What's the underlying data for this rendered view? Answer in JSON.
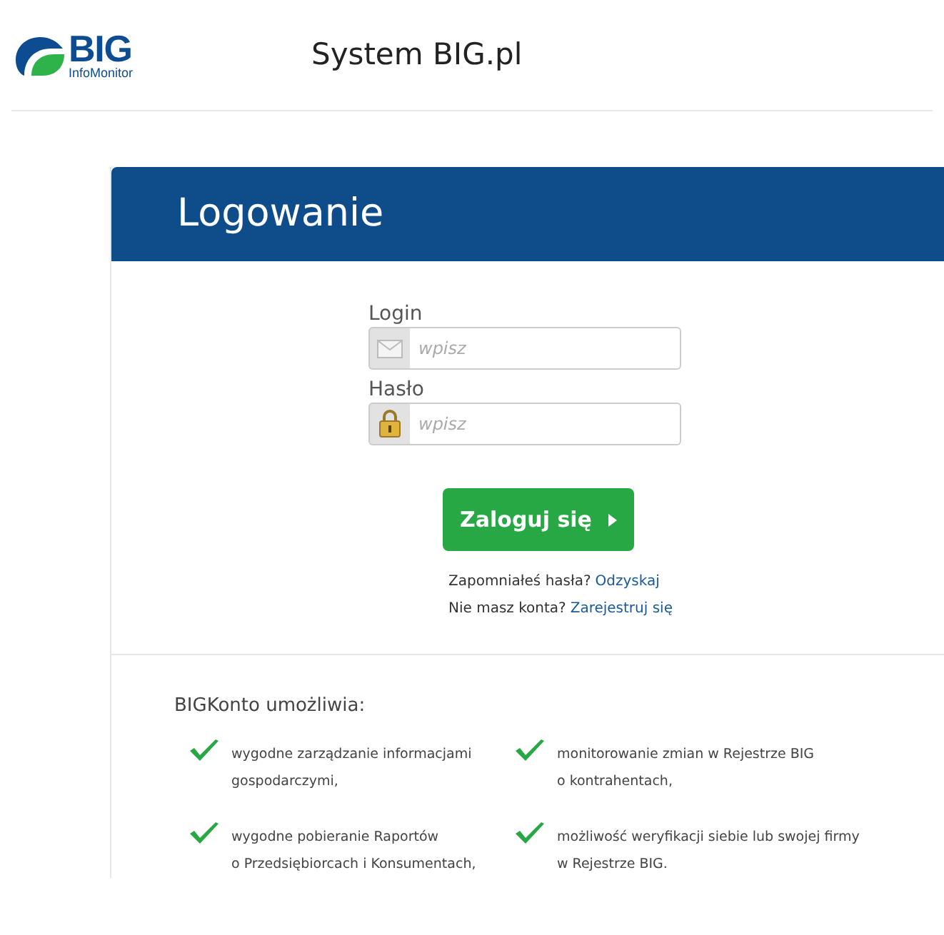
{
  "logo": {
    "name": "BIG",
    "subtitle": "InfoMonitor"
  },
  "header": {
    "title": "System BIG.pl"
  },
  "panel": {
    "title": "Logowanie"
  },
  "form": {
    "fields": [
      {
        "label": "Login",
        "placeholder": "wpisz",
        "kind": "mail"
      },
      {
        "label": "Hasło",
        "placeholder": "wpisz",
        "kind": "lock"
      }
    ],
    "submit": "Zaloguj się",
    "links": [
      {
        "text": "Zapomniałeś hasła?",
        "link": "Odzyskaj"
      },
      {
        "text": "Nie masz konta?",
        "link": "Zarejestruj się"
      }
    ]
  },
  "features": {
    "title": "BIGKonto umożliwia:",
    "items": [
      "wygodne zarządzanie informacjami\ngospodarczymi,",
      "monitorowanie zmian w Rejestrze BIG\no kontrahentach,",
      "wygodne pobieranie Raportów\no Przedsiębiorcach i Konsumentach,",
      "możliwość weryfikacji siebie lub swojej firmy\nw Rejestrze BIG."
    ]
  }
}
